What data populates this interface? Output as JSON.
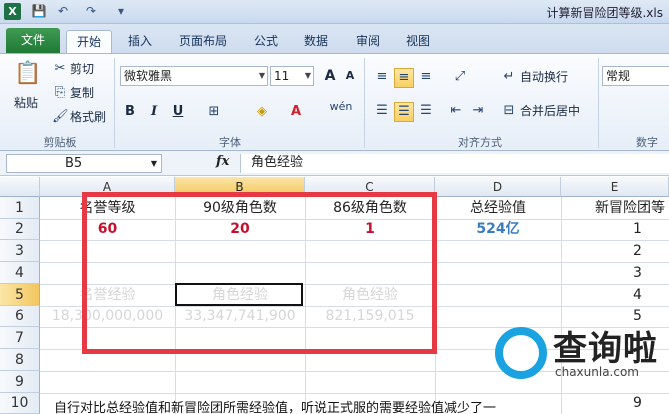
{
  "window": {
    "title": "计算新冒险团等级.xls",
    "app_icon": "X"
  },
  "quick_access": {
    "save_icon": "💾",
    "undo_icon": "↶",
    "redo_icon": "↷",
    "customize_icon": "▾"
  },
  "tabs": [
    {
      "label": "文件"
    },
    {
      "label": "开始"
    },
    {
      "label": "插入"
    },
    {
      "label": "页面布局"
    },
    {
      "label": "公式"
    },
    {
      "label": "数据"
    },
    {
      "label": "审阅"
    },
    {
      "label": "视图"
    }
  ],
  "ribbon": {
    "clipboard": {
      "paste": "粘贴",
      "cut": "剪切",
      "copy": "复制",
      "format_painter": "格式刷",
      "group": "剪贴板"
    },
    "font": {
      "name": "微软雅黑",
      "size": "11",
      "bold": "B",
      "italic": "I",
      "underline": "U",
      "group": "字体",
      "grow": "A",
      "shrink": "A",
      "wen": "wén"
    },
    "alignment": {
      "wrap": "自动换行",
      "merge": "合并后居中",
      "group": "对齐方式"
    },
    "number": {
      "format": "常规",
      "group": "数字"
    }
  },
  "formula_bar": {
    "name_box": "B5",
    "fx": "fx",
    "content": "角色经验"
  },
  "columns": [
    "A",
    "B",
    "C",
    "D",
    "E"
  ],
  "rows": [
    "1",
    "2",
    "3",
    "4",
    "5",
    "6",
    "7",
    "8",
    "9",
    "10"
  ],
  "cells": {
    "A1": "名誉等级",
    "B1": "90级角色数",
    "C1": "86级角色数",
    "D1": "总经验值",
    "E1": "新冒险团等",
    "A2": "60",
    "B2": "20",
    "C2": "1",
    "D2": "524亿",
    "E2": "1",
    "E3": "2",
    "E4": "3",
    "A5": "名誉经验",
    "B5": "角色经验",
    "C5": "角色经验",
    "E5": "4",
    "A6": "18,300,000,000",
    "B6": "33,347,741,900",
    "C6": "821,159,015",
    "E6": "5",
    "E10": "9"
  },
  "note": "自行对比总经验值和新冒险团所需经验值，听说正式服的需要经验值减少了一",
  "watermark": {
    "brand": "查询啦",
    "domain": "chaxunla.com"
  },
  "colors": {
    "highlight_box": "#e53a43",
    "red_value": "#c8102e",
    "blue_value": "#3a7cbf",
    "file_tab": "#1f7a36"
  }
}
